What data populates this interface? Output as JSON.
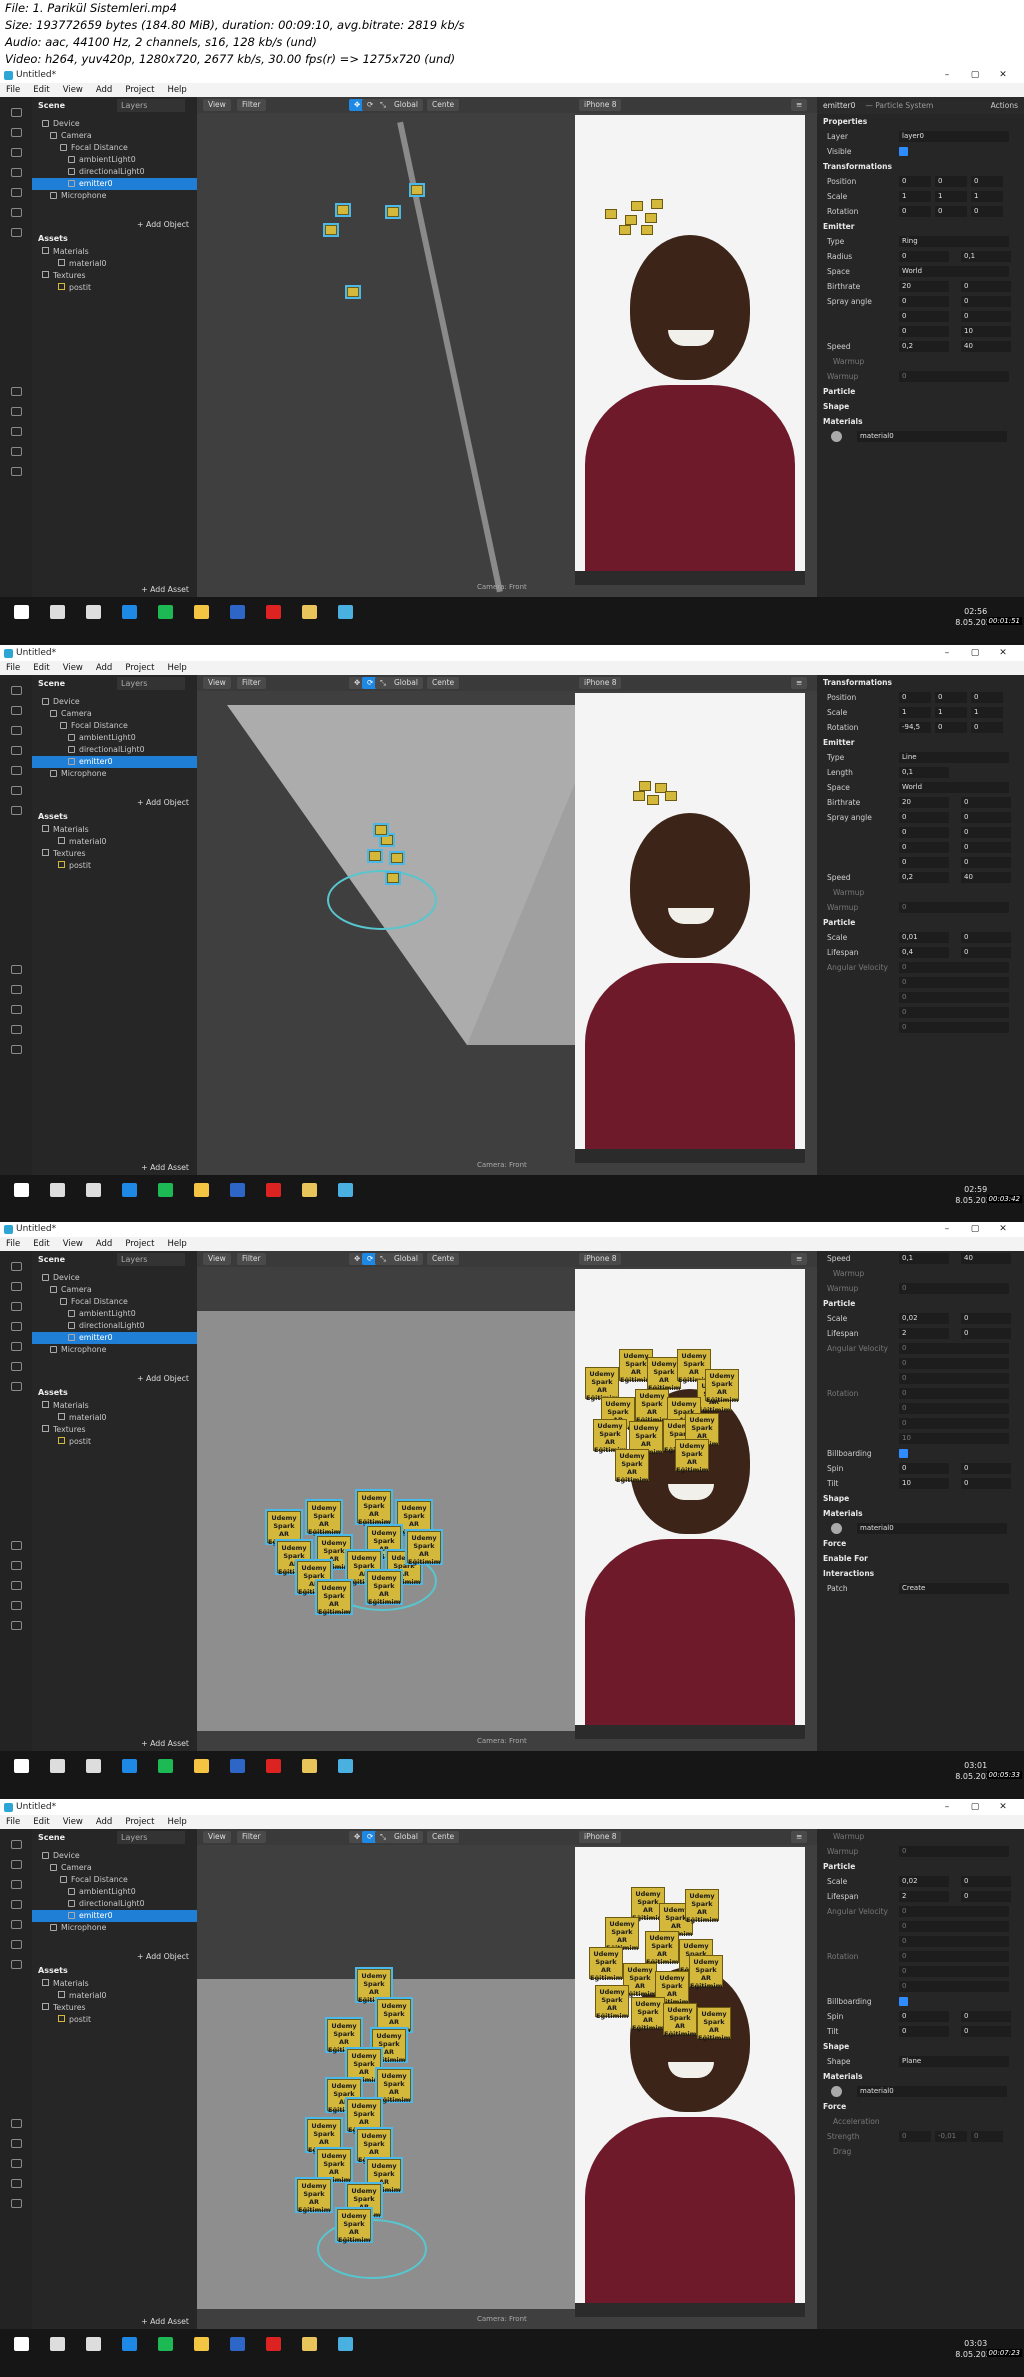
{
  "header": {
    "line1": "File: 1. Parikül Sistemleri.mp4",
    "line2": "Size: 193772659 bytes (184.80 MiB), duration: 00:09:10, avg.bitrate: 2819 kb/s",
    "line3": "Audio: aac, 44100 Hz, 2 channels, s16, 128 kb/s (und)",
    "line4": "Video: h264, yuv420p, 1280x720, 2677 kb/s, 30.00 fps(r) => 1275x720 (und)"
  },
  "app": {
    "title": "Untitled*",
    "win_controls": [
      "–",
      "▢",
      "✕"
    ]
  },
  "menu": [
    "File",
    "Edit",
    "View",
    "Add",
    "Project",
    "Help"
  ],
  "scene": {
    "tab_scene": "Scene",
    "tab_layers": "Layers",
    "items": [
      "Device",
      "Camera",
      "Focal Distance",
      "ambientLight0",
      "directionalLight0",
      "emitter0",
      "Microphone"
    ],
    "add_object": "+ Add Object"
  },
  "assets": {
    "title": "Assets",
    "items": [
      "Materials",
      "material0",
      "Textures",
      "postit"
    ],
    "add_asset": "+ Add Asset"
  },
  "viewport": {
    "view": "View",
    "filter": "Filter",
    "global": "Global",
    "center": "Cente",
    "device": "iPhone 8",
    "camera_label": "Camera: Front"
  },
  "note_text": "Udemy Spark AR Eğitimim",
  "inspector": {
    "title": "emitter0",
    "subtitle": "— Particle System",
    "actions": "Actions"
  },
  "frames": [
    {
      "clock_time": "02:56",
      "clock_date": "8.05.2020",
      "stamp": "00:01:51",
      "props": [
        [
          "sec",
          "Properties"
        ],
        [
          "cb",
          "Layer",
          "layer0"
        ],
        [
          "chk",
          "Visible"
        ],
        [
          "sec",
          "Transformations"
        ],
        [
          "v3",
          "Position",
          "0",
          "0",
          "0"
        ],
        [
          "v3",
          "Scale",
          "1",
          "1",
          "1"
        ],
        [
          "v3",
          "Rotation",
          "0",
          "0",
          "0"
        ],
        [
          "sec",
          "Emitter"
        ],
        [
          "dd",
          "Type",
          "Ring"
        ],
        [
          "v2",
          "Radius",
          "0",
          "0,1"
        ],
        [
          "dd",
          "Space",
          "World"
        ],
        [
          "v2",
          "Birthrate",
          "20",
          "0"
        ],
        [
          "v2",
          "Spray angle",
          "0",
          "0"
        ],
        [
          "v2",
          "",
          "0",
          "0"
        ],
        [
          "v2",
          "",
          "0",
          "10"
        ],
        [
          "v2",
          "Speed",
          "0,2",
          "40"
        ],
        [
          "sub",
          "Warmup"
        ],
        [
          "dim",
          "Warmup",
          "0"
        ],
        [
          "sec",
          "Particle"
        ],
        [
          "sec",
          "Shape"
        ],
        [
          "sec",
          "Materials"
        ],
        [
          "mat",
          "material0"
        ]
      ]
    },
    {
      "clock_time": "02:59",
      "clock_date": "8.05.2020",
      "stamp": "00:03:42",
      "props": [
        [
          "sec",
          "Transformations"
        ],
        [
          "v3",
          "Position",
          "0",
          "0",
          "0"
        ],
        [
          "v3",
          "Scale",
          "1",
          "1",
          "1"
        ],
        [
          "v3",
          "Rotation",
          "-94,5",
          "0",
          "0"
        ],
        [
          "sec",
          "Emitter"
        ],
        [
          "dd",
          "Type",
          "Line"
        ],
        [
          "v1",
          "Length",
          "0,1"
        ],
        [
          "dd",
          "Space",
          "World"
        ],
        [
          "v2",
          "Birthrate",
          "20",
          "0"
        ],
        [
          "v2",
          "Spray angle",
          "0",
          "0"
        ],
        [
          "v2",
          "",
          "0",
          "0"
        ],
        [
          "v2",
          "",
          "0",
          "0"
        ],
        [
          "v2",
          "",
          "0",
          "0"
        ],
        [
          "v2",
          "Speed",
          "0,2",
          "40"
        ],
        [
          "sub",
          "Warmup"
        ],
        [
          "dim",
          "Warmup",
          "0"
        ],
        [
          "sec",
          "Particle"
        ],
        [
          "v2",
          "Scale",
          "0,01",
          "0"
        ],
        [
          "v2",
          "Lifespan",
          "0,4",
          "0"
        ],
        [
          "dim",
          "Angular Velocity",
          "0"
        ],
        [
          "dim",
          "",
          "0"
        ],
        [
          "dim",
          "",
          "0"
        ],
        [
          "dim",
          "",
          "0"
        ],
        [
          "dim",
          "",
          "0"
        ]
      ]
    },
    {
      "clock_time": "03:01",
      "clock_date": "8.05.2020",
      "stamp": "00:05:33",
      "props": [
        [
          "v2",
          "Speed",
          "0,1",
          "40"
        ],
        [
          "sub",
          "Warmup"
        ],
        [
          "dim",
          "Warmup",
          "0"
        ],
        [
          "sec",
          "Particle"
        ],
        [
          "v2",
          "Scale",
          "0,02",
          "0"
        ],
        [
          "v2",
          "Lifespan",
          "2",
          "0"
        ],
        [
          "dim",
          "Angular Velocity",
          "0"
        ],
        [
          "dim",
          "",
          "0"
        ],
        [
          "dim",
          "",
          "0"
        ],
        [
          "dim",
          "Rotation",
          "0"
        ],
        [
          "dim",
          "",
          "0"
        ],
        [
          "dim",
          "",
          "0"
        ],
        [
          "dim",
          "",
          "10"
        ],
        [
          "chk",
          "Billboarding"
        ],
        [
          "v2",
          "Spin",
          "0",
          "0"
        ],
        [
          "v2",
          "Tilt",
          "10",
          "0"
        ],
        [
          "sec",
          "Shape"
        ],
        [
          "sec",
          "Materials"
        ],
        [
          "mat",
          "material0"
        ],
        [
          "sec",
          "Force"
        ],
        [
          "sec",
          "Enable For"
        ],
        [
          "sec",
          "Interactions"
        ],
        [
          "btn",
          "Patch",
          "Create"
        ]
      ]
    },
    {
      "clock_time": "03:03",
      "clock_date": "8.05.2020",
      "stamp": "00:07:23",
      "props": [
        [
          "sub",
          "Warmup"
        ],
        [
          "dim",
          "Warmup",
          "0"
        ],
        [
          "sec",
          "Particle"
        ],
        [
          "v2",
          "Scale",
          "0,02",
          "0"
        ],
        [
          "v2",
          "Lifespan",
          "2",
          "0"
        ],
        [
          "dim",
          "Angular Velocity",
          "0"
        ],
        [
          "dim",
          "",
          "0"
        ],
        [
          "dim",
          "",
          "0"
        ],
        [
          "dim",
          "Rotation",
          "0"
        ],
        [
          "dim",
          "",
          "0"
        ],
        [
          "dim",
          "",
          "0"
        ],
        [
          "chk",
          "Billboarding"
        ],
        [
          "v2",
          "Spin",
          "0",
          "0"
        ],
        [
          "v2",
          "Tilt",
          "0",
          "0"
        ],
        [
          "sec",
          "Shape"
        ],
        [
          "dd",
          "Shape",
          "Plane"
        ],
        [
          "sec",
          "Materials"
        ],
        [
          "mat",
          "material0"
        ],
        [
          "sec",
          "Force"
        ],
        [
          "sub",
          "Acceleration"
        ],
        [
          "dim3",
          "Strength",
          "0",
          "-0,01",
          "0"
        ],
        [
          "sub",
          "Drag"
        ]
      ]
    }
  ]
}
